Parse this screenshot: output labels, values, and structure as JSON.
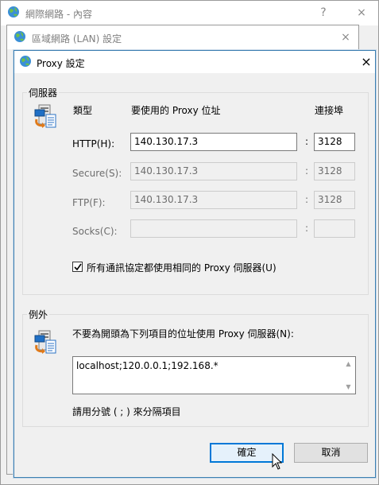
{
  "window_internet": {
    "title": "網際網路 - 內容",
    "help": "?",
    "close": "×"
  },
  "window_lan": {
    "title": "區域網路 (LAN) 設定",
    "close": "×"
  },
  "dialog": {
    "title": "Proxy 設定",
    "close": "×",
    "servers": {
      "group_label": "伺服器",
      "col_type": "類型",
      "col_address": "要使用的 Proxy 位址",
      "col_port": "連接埠",
      "rows": [
        {
          "label": "HTTP(H):",
          "address": "140.130.17.3",
          "port": "3128",
          "enabled": true
        },
        {
          "label": "Secure(S):",
          "address": "140.130.17.3",
          "port": "3128",
          "enabled": false
        },
        {
          "label": "FTP(F):",
          "address": "140.130.17.3",
          "port": "3128",
          "enabled": false
        },
        {
          "label": "Socks(C):",
          "address": "",
          "port": "",
          "enabled": false
        }
      ],
      "colon": ":",
      "same_proxy_label": "所有通訊協定都使用相同的 Proxy 伺服器(U)",
      "same_proxy_checked": true
    },
    "exceptions": {
      "group_label": "例外",
      "description": "不要為開頭為下列項目的位址使用 Proxy 伺服器(N):",
      "value": "localhost;120.0.0.1;192.168.*",
      "hint": "請用分號 ( ; ) 來分隔項目"
    },
    "ok_label": "確定",
    "cancel_label": "取消"
  },
  "colors": {
    "accent": "#0078d7",
    "dialog_border": "#3c7fb1"
  }
}
